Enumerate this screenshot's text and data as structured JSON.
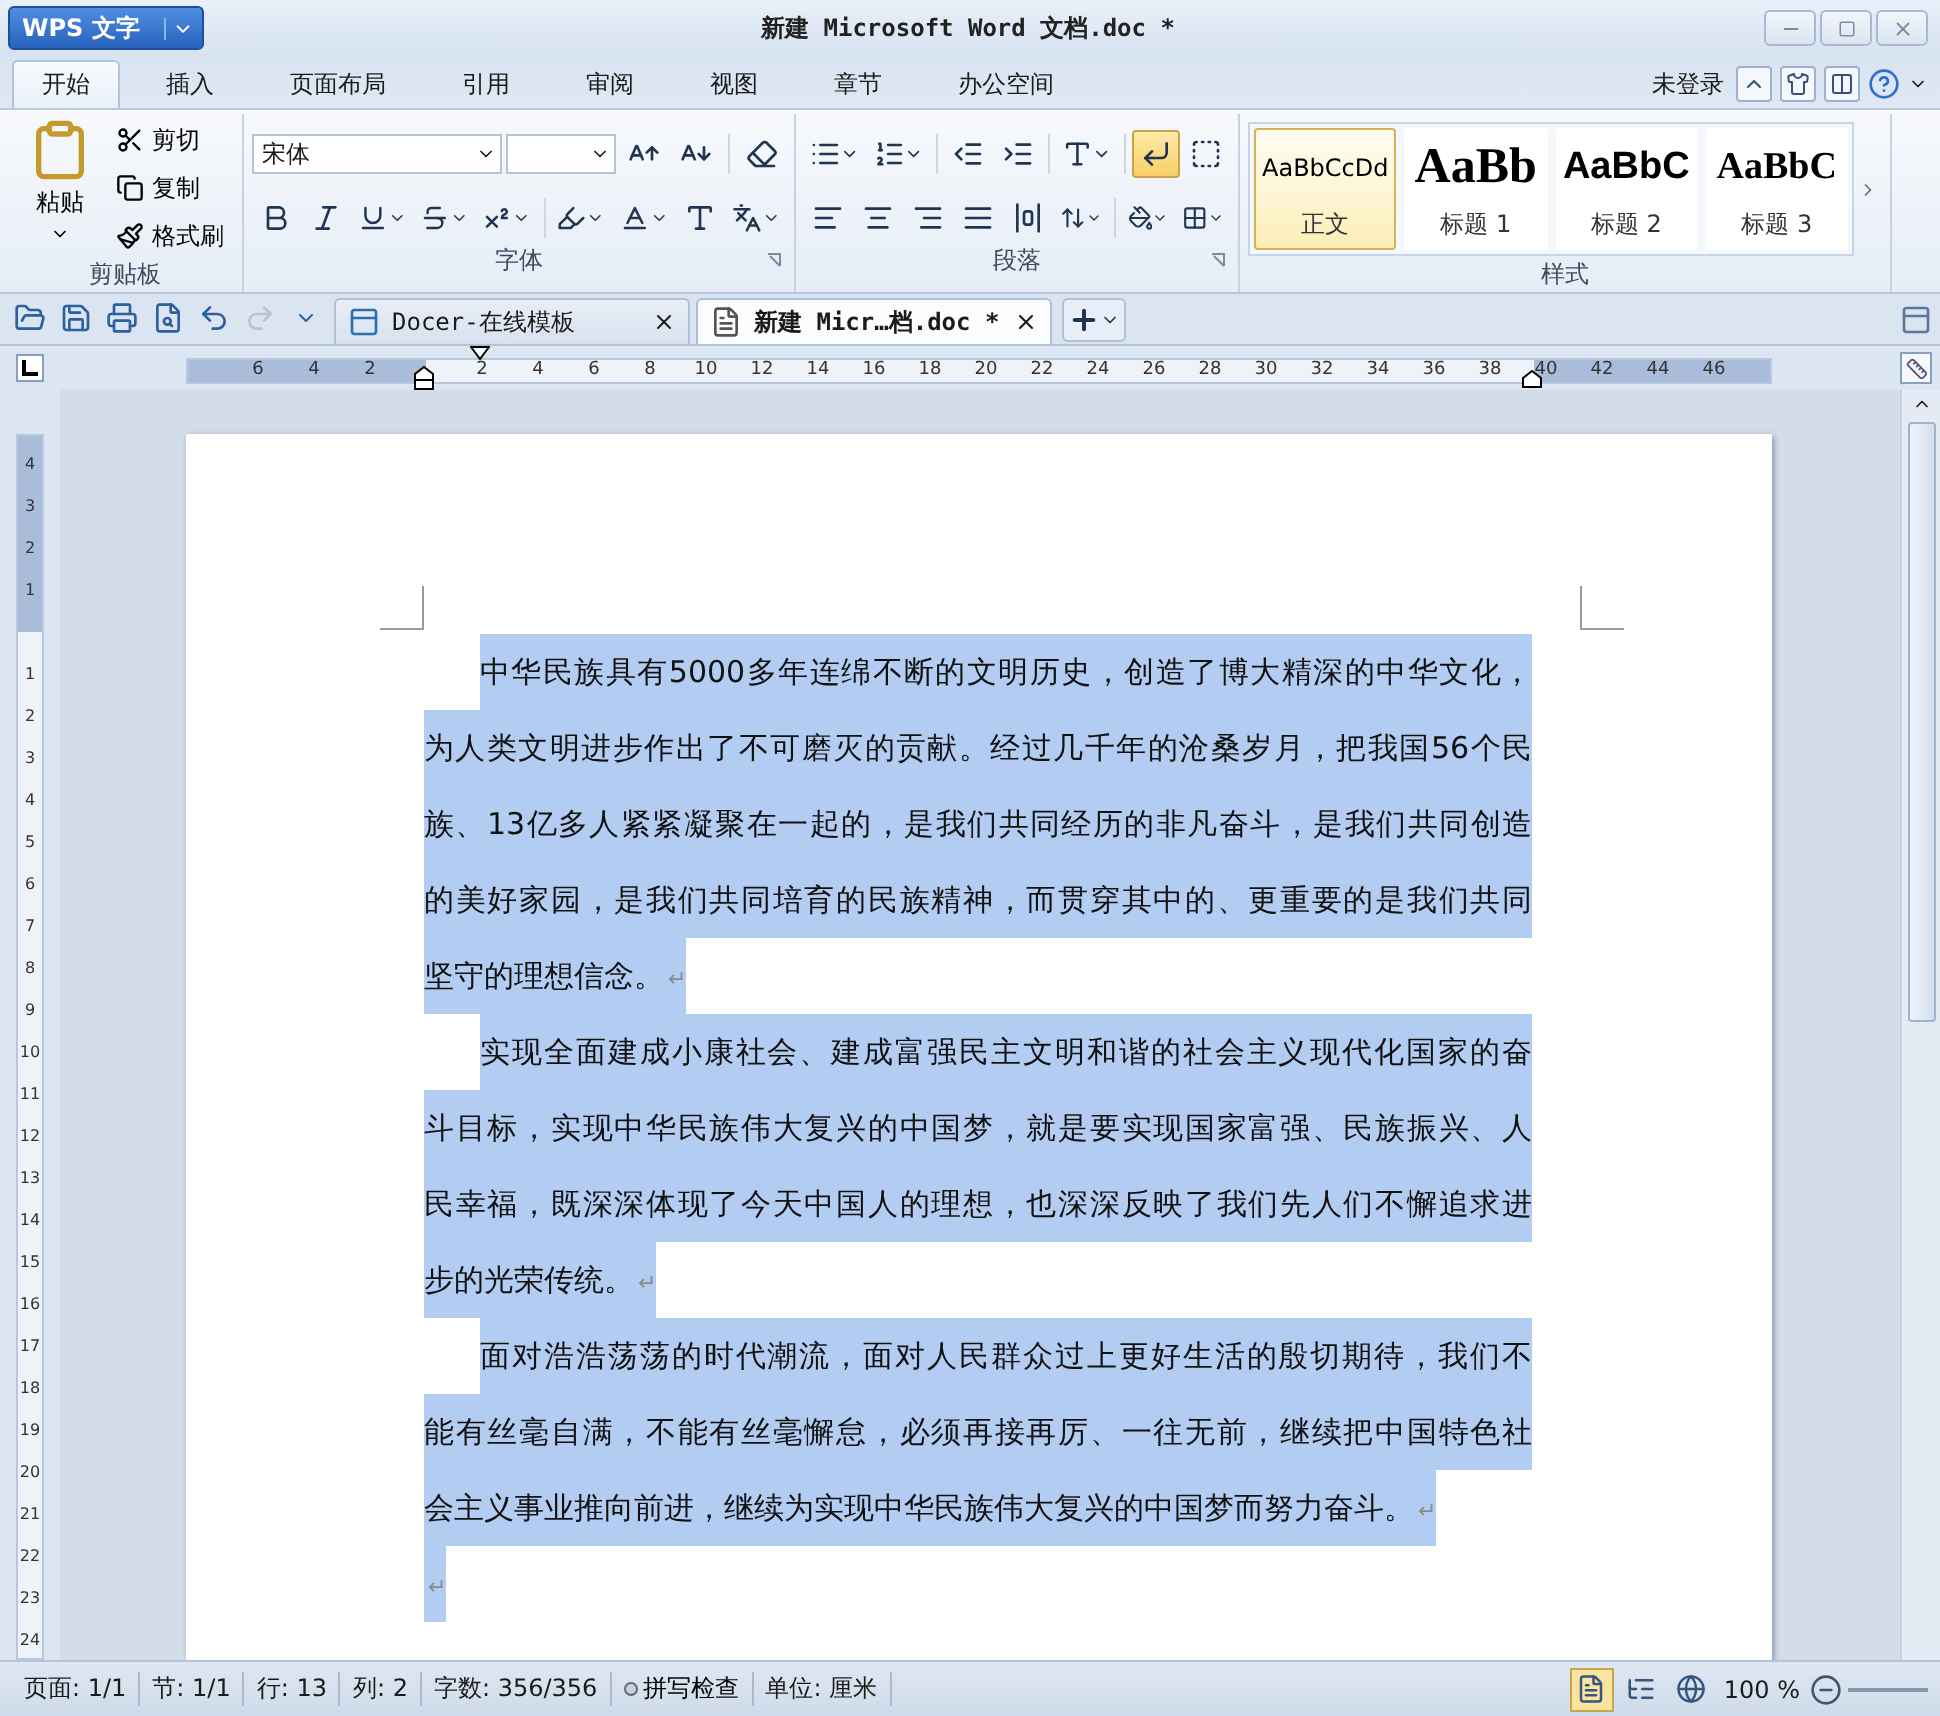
{
  "window": {
    "app_button": "WPS 文字",
    "title": "新建 Microsoft Word 文档.doc *"
  },
  "menu_tabs": [
    {
      "label": "开始",
      "selected": true
    },
    {
      "label": "插入",
      "selected": false
    },
    {
      "label": "页面布局",
      "selected": false
    },
    {
      "label": "引用",
      "selected": false
    },
    {
      "label": "审阅",
      "selected": false
    },
    {
      "label": "视图",
      "selected": false
    },
    {
      "label": "章节",
      "selected": false
    },
    {
      "label": "办公空间",
      "selected": false
    }
  ],
  "account": {
    "label": "未登录"
  },
  "ribbon": {
    "clipboard": {
      "paste": "粘贴",
      "cut": "剪切",
      "copy": "复制",
      "format_painter": "格式刷",
      "label": "剪贴板"
    },
    "font": {
      "name": "宋体",
      "label": "字体"
    },
    "paragraph": {
      "label": "段落",
      "show_marks_on": true
    },
    "styles": {
      "label": "样式",
      "items": [
        {
          "preview": "AaBbCcDd",
          "caption": "正文",
          "kind": "body",
          "selected": true
        },
        {
          "preview": "AaBb",
          "caption": "标题 1",
          "kind": "heading1",
          "selected": false
        },
        {
          "preview": "AaBbC",
          "caption": "标题 2",
          "kind": "heading2",
          "selected": false
        },
        {
          "preview": "AaBbC",
          "caption": "标题 3",
          "kind": "heading3",
          "selected": false
        }
      ]
    }
  },
  "quick_access": [
    {
      "kind": "open",
      "disabled": false
    },
    {
      "kind": "save",
      "disabled": false
    },
    {
      "kind": "print",
      "disabled": false
    },
    {
      "kind": "preview",
      "disabled": false
    },
    {
      "kind": "undo",
      "disabled": false
    },
    {
      "kind": "redo",
      "disabled": true
    }
  ],
  "doc_tabs": [
    {
      "label": "Docer-在线模板",
      "kind": "docer",
      "selected": false
    },
    {
      "label": "新建 Micr…档.doc *",
      "kind": "document",
      "selected": true
    }
  ],
  "ruler": {
    "left_labels": [
      "6",
      "4",
      "2"
    ],
    "right_labels": [
      "2",
      "4",
      "6",
      "8",
      "10",
      "12",
      "14",
      "16",
      "18",
      "20",
      "22",
      "24",
      "26",
      "28",
      "30",
      "32",
      "34",
      "36",
      "38",
      "40",
      "42",
      "44",
      "46"
    ],
    "top_labels": [
      "4",
      "3",
      "2",
      "1"
    ],
    "body_labels": [
      "1",
      "2",
      "3",
      "4",
      "5",
      "6",
      "7",
      "8",
      "9",
      "10",
      "11",
      "12",
      "13",
      "14",
      "15",
      "16",
      "17",
      "18",
      "19",
      "20",
      "21",
      "22",
      "23",
      "24"
    ]
  },
  "document": {
    "paragraphs": [
      {
        "selected": true,
        "end_mark": "↵",
        "lines": [
          "中华民族具有5000多年连绵不断的文明历史，创造了博大精深的中华文化，",
          "为人类文明进步作出了不可磨灭的贡献。经过几千年的沧桑岁月，把我国56个民",
          "族、13亿多人紧紧凝聚在一起的，是我们共同经历的非凡奋斗，是我们共同创造",
          "的美好家园，是我们共同培育的民族精神，而贯穿其中的、更重要的是我们共同",
          "坚守的理想信念。"
        ]
      },
      {
        "selected": true,
        "end_mark": "↵",
        "lines": [
          "实现全面建成小康社会、建成富强民主文明和谐的社会主义现代化国家的奋",
          "斗目标，实现中华民族伟大复兴的中国梦，就是要实现国家富强、民族振兴、人",
          "民幸福，既深深体现了今天中国人的理想，也深深反映了我们先人们不懈追求进",
          "步的光荣传统。"
        ]
      },
      {
        "selected": true,
        "end_mark": "↵",
        "lines": [
          "面对浩浩荡荡的时代潮流，面对人民群众过上更好生活的殷切期待，我们不",
          "能有丝毫自满，不能有丝毫懈怠，必须再接再厉、一往无前，继续把中国特色社",
          "会主义事业推向前进，继续为实现中华民族伟大复兴的中国梦而努力奋斗。"
        ]
      },
      {
        "selected": true,
        "end_mark": "↵"
      }
    ]
  },
  "status_bar": {
    "items": [
      "页面: 1/1",
      "节: 1/1",
      "行: 13",
      "列: 2",
      "字数: 356/356"
    ],
    "spell_check": "拼写检查",
    "unit": "单位: 厘米",
    "views": [
      {
        "kind": "page",
        "selected": true
      },
      {
        "kind": "outline",
        "selected": false
      },
      {
        "kind": "web",
        "selected": false
      }
    ],
    "zoom": "100 %"
  }
}
